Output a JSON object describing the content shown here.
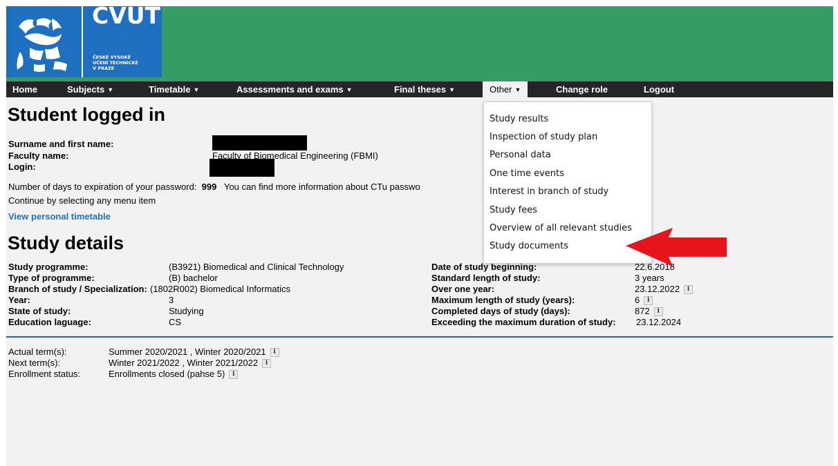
{
  "logo": {
    "wordmark": "CVUT",
    "uni_lines": [
      "ČESKÉ VYSOKÉ",
      "UČENÍ TECHNICKÉ",
      "V PRAZE"
    ]
  },
  "nav": [
    {
      "label": "Home",
      "caret": false
    },
    {
      "label": "Subjects",
      "caret": true
    },
    {
      "label": "Timetable",
      "caret": true
    },
    {
      "label": "Assessments and exams",
      "caret": true
    },
    {
      "label": "Final theses",
      "caret": true
    },
    {
      "label": "Other",
      "caret": true,
      "active": true
    },
    {
      "label": "Change role",
      "caret": false
    },
    {
      "label": "Logout",
      "caret": false
    }
  ],
  "dropdown": [
    "Study results",
    "Inspection of study plan",
    "Personal data",
    "One time events",
    "Interest in branch of study",
    "Study fees",
    "Overview of all relevant studies",
    "Study documents"
  ],
  "login_section": {
    "title": "Student logged in",
    "surname_label": "Surname and first name:",
    "faculty_label": "Faculty name:",
    "faculty_value": "Faculty of Biomedical Engineering (FBMI)",
    "login_label": "Login:",
    "password_prefix": "Number of days to expiration of your password:",
    "password_days": "999",
    "password_suffix": "You can find more information about CTu passwo",
    "continue_text": "Continue by selecting any menu item",
    "timetable_link": "View personal timetable"
  },
  "study": {
    "title": "Study details",
    "left": [
      {
        "label": "Study programme:",
        "value": "(B3921) Biomedical and Clinical Technology"
      },
      {
        "label": "Type of programme:",
        "value": "(B) bachelor"
      },
      {
        "label": "Branch of study / Specialization:",
        "value": "(1802R002) Biomedical Informatics"
      },
      {
        "label": "Year:",
        "value": "3"
      },
      {
        "label": "State of study:",
        "value": "Studying"
      },
      {
        "label": "Education laguage:",
        "value": "CS"
      }
    ],
    "right": [
      {
        "label": "Date of study beginning:",
        "value": "22.6.2018",
        "info": false
      },
      {
        "label": "Standard length of study:",
        "value": "3 years",
        "info": false
      },
      {
        "label": "Over one year:",
        "value": "23.12.2022",
        "info": true
      },
      {
        "label": "Maximum length of study (years):",
        "value": "6",
        "info": true
      },
      {
        "label": "Completed days of study (days):",
        "value": "872",
        "info": true
      },
      {
        "label": "Exceeding the maximum duration of study:",
        "value": "23.12.2024",
        "info": false
      }
    ]
  },
  "terms": [
    {
      "label": "Actual term(s):",
      "value": "Summer 2020/2021 , Winter 2020/2021"
    },
    {
      "label": "Next term(s):",
      "value": "Winter 2021/2022 , Winter 2021/2022"
    },
    {
      "label": "Enrollment status:",
      "value": "Enrollments closed (pahse 5)"
    }
  ],
  "colors": {
    "header": "#379b64",
    "logo": "#1f6fc1",
    "navbar": "#262626",
    "link": "#1f6fc1",
    "arrow": "#e8161c"
  }
}
